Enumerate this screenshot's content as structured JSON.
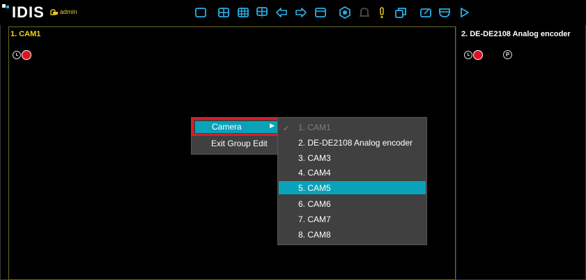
{
  "app": {
    "logo": "IDIS",
    "user": "admin"
  },
  "toolbar": {
    "icons": [
      "single-layout-icon",
      "quad-layout-icon",
      "grid-9-layout-icon",
      "custom-layout-icon",
      "previous-group-icon",
      "next-group-icon",
      "fullscreen-icon",
      "camera-group-icon",
      "alarm-bell-icon",
      "alarm-out-icon",
      "copy-icon",
      "edit-icon",
      "ptz-icon",
      "play-icon"
    ]
  },
  "panes": [
    {
      "title": "1. CAM1"
    },
    {
      "title": "2. DE-DE2108 Analog encoder"
    }
  ],
  "context_menu": {
    "items": [
      {
        "label": "Camera",
        "selected": true,
        "has_submenu": true
      },
      {
        "label": "Exit Group Edit"
      }
    ]
  },
  "camera_submenu": {
    "items": [
      {
        "label": "1. CAM1",
        "disabled": true,
        "checked": true
      },
      {
        "label": "2. DE-DE2108 Analog encoder"
      },
      {
        "label": "3. CAM3"
      },
      {
        "label": "4. CAM4"
      },
      {
        "label": "5. CAM5",
        "selected": true
      },
      {
        "label": "6. CAM6"
      },
      {
        "label": "7. CAM7"
      },
      {
        "label": "8. CAM8"
      }
    ]
  },
  "colors": {
    "accent": "#0aa2b8",
    "highlight_border": "#d4202a",
    "pane_title": "#f1d41b",
    "record": "#e0131c"
  }
}
